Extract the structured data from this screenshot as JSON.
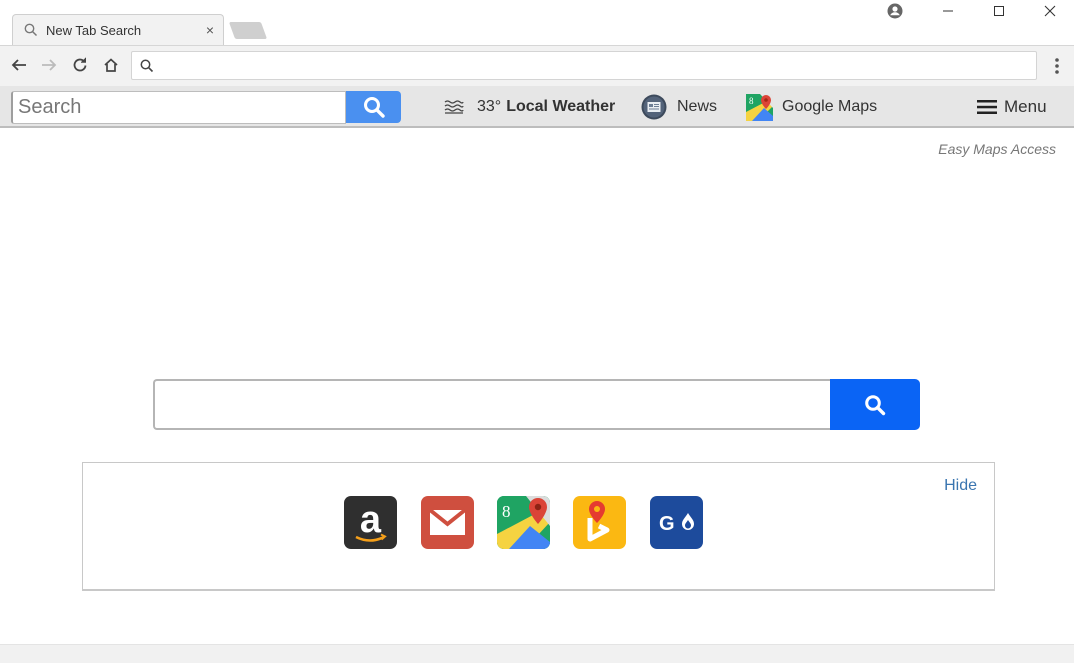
{
  "browser": {
    "tab": {
      "title": "New Tab Search",
      "icon": "search-icon",
      "close": "×"
    },
    "window_controls": {
      "profile": "profile-icon",
      "minimize": "–",
      "maximize": "□",
      "close": "×"
    },
    "omnibox": {
      "value": "",
      "placeholder": ""
    }
  },
  "extension_bar": {
    "search_placeholder": "Search",
    "weather": {
      "temperature": "33°",
      "label": "Local Weather",
      "icon": "weather-fog-icon"
    },
    "news": {
      "label": "News",
      "icon": "news-icon"
    },
    "maps": {
      "label": "Google Maps",
      "icon": "google-maps-icon"
    },
    "menu": {
      "label": "Menu",
      "icon": "hamburger-icon"
    }
  },
  "page": {
    "tagline": "Easy Maps Access",
    "main_search": {
      "value": "",
      "placeholder": ""
    },
    "quick_links": {
      "hide_label": "Hide",
      "items": [
        {
          "name": "Amazon",
          "icon": "amazon-icon",
          "color": "#2f2f2f"
        },
        {
          "name": "Gmail",
          "icon": "gmail-icon",
          "color": "#cf4f3f"
        },
        {
          "name": "Google Maps",
          "icon": "google-maps-icon",
          "color": "#1fa463"
        },
        {
          "name": "Bing Maps",
          "icon": "bing-maps-icon",
          "color": "#fbb812"
        },
        {
          "name": "Gas Buddy",
          "icon": "gasbuddy-icon",
          "color": "#1d4b9c"
        }
      ]
    }
  },
  "colors": {
    "search_blue": "#0a64f5",
    "ext_search_blue": "#4a90f0",
    "link_blue": "#3a75b0"
  }
}
